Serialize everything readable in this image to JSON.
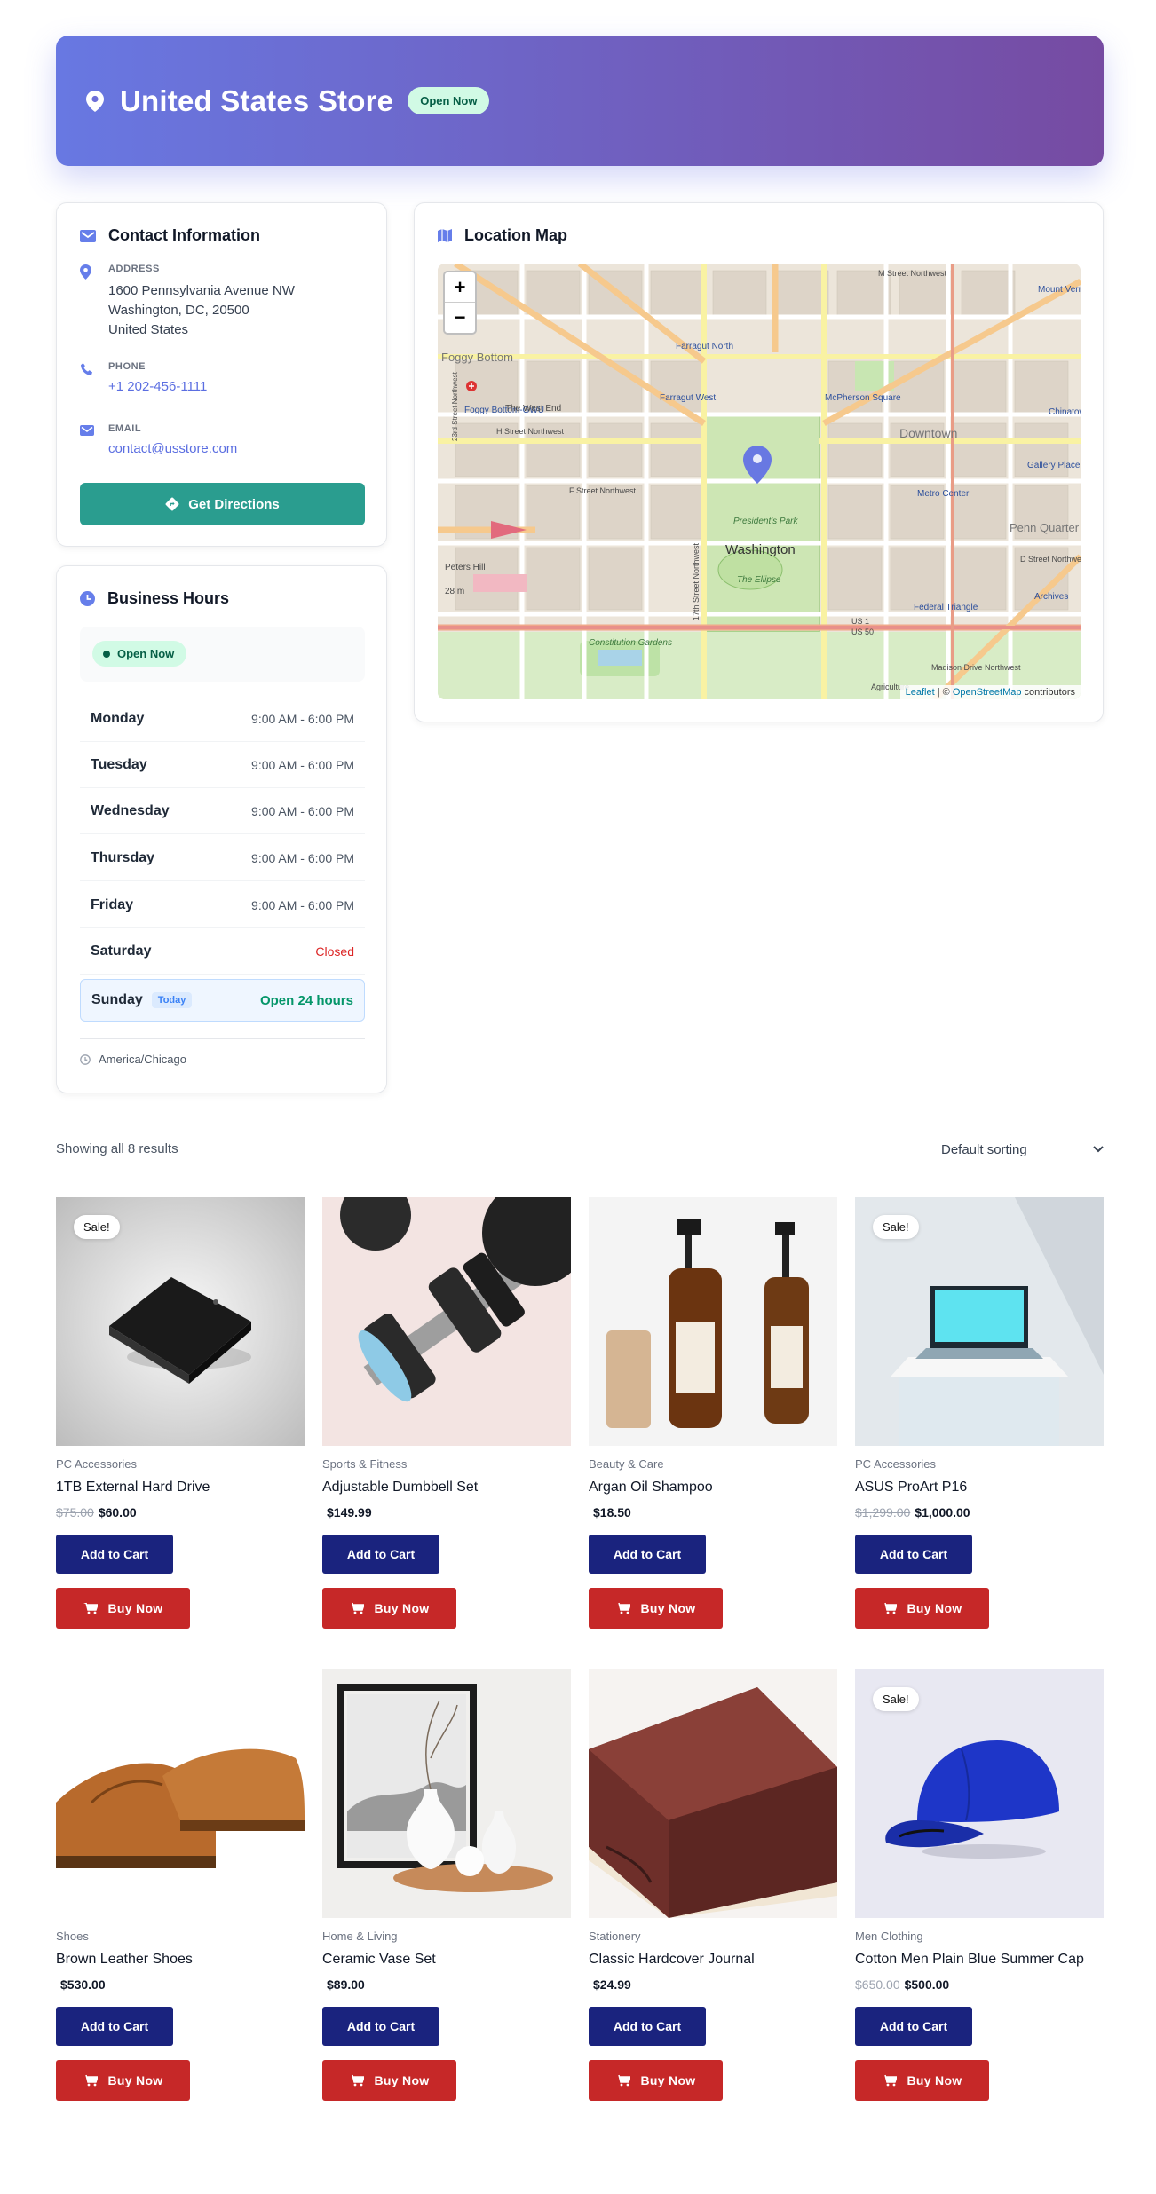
{
  "header": {
    "title": "United States Store",
    "status_badge": "Open Now"
  },
  "contact": {
    "title": "Contact Information",
    "address_label": "ADDRESS",
    "address_lines": [
      "1600 Pennsylvania Avenue NW",
      "Washington, DC, 20500",
      "United States"
    ],
    "phone_label": "PHONE",
    "phone": "+1 202-456-1111",
    "email_label": "EMAIL",
    "email": "contact@usstore.com",
    "directions_button": "Get Directions"
  },
  "hours": {
    "title": "Business Hours",
    "status": "Open Now",
    "days": [
      {
        "day": "Monday",
        "time": "9:00 AM - 6:00 PM"
      },
      {
        "day": "Tuesday",
        "time": "9:00 AM - 6:00 PM"
      },
      {
        "day": "Wednesday",
        "time": "9:00 AM - 6:00 PM"
      },
      {
        "day": "Thursday",
        "time": "9:00 AM - 6:00 PM"
      },
      {
        "day": "Friday",
        "time": "9:00 AM - 6:00 PM"
      },
      {
        "day": "Saturday",
        "time": "Closed"
      },
      {
        "day": "Sunday",
        "time": "Open 24 hours",
        "today_badge": "Today"
      }
    ],
    "timezone": "America/Chicago"
  },
  "map": {
    "title": "Location Map",
    "zoom_in": "+",
    "zoom_out": "−",
    "attribution_leaflet": "Leaflet",
    "attribution_osm": "OpenStreetMap",
    "attribution_rest": " contributors",
    "labels": {
      "foggy_bottom": "Foggy Bottom",
      "foggy_bottom_gwu": "Foggy Bottom-GWU",
      "west_end": "The West End",
      "h_street": "H Street Northwest",
      "f_street": "F Street Northwest",
      "farragut_north": "Farragut North",
      "farragut_west": "Farragut West",
      "mcpherson": "McPherson Square",
      "downtown": "Downtown",
      "metro_center": "Metro Center",
      "presidents_park": "President's Park",
      "washington": "Washington",
      "ellipse": "The Ellipse",
      "constitution_gardens": "Constitution Gardens",
      "federal_triangle": "Federal Triangle",
      "penn_quarter": "Penn Quarter",
      "archives": "Archives",
      "gallery_place": "Gallery Place",
      "chinatown": "Chinatown",
      "mount_vernon": "Mount Vernon Square",
      "m_street": "M Street Northwest",
      "d_street": "D Street Northwest",
      "madison": "Madison Drive Northwest",
      "us1": "US 1",
      "us50": "US 50",
      "seventeenth": "17th Street Northwest",
      "twentythird": "23rd Street Northwest",
      "agriculture": "Agriculture",
      "peters_hill": "Peters Hill",
      "pmm": "28 m"
    }
  },
  "shop": {
    "results_text": "Showing all 8 results",
    "sorting": "Default sorting",
    "add_to_cart": "Add to Cart",
    "buy_now": "Buy Now",
    "sale_badge": "Sale!",
    "products": [
      {
        "category": "PC Accessories",
        "name": "1TB External Hard Drive",
        "old_price": "$75.00",
        "price": "$60.00",
        "sale": true
      },
      {
        "category": "Sports & Fitness",
        "name": "Adjustable Dumbbell Set",
        "old_price": "",
        "price": "$149.99",
        "sale": false
      },
      {
        "category": "Beauty & Care",
        "name": "Argan Oil Shampoo",
        "old_price": "",
        "price": "$18.50",
        "sale": false
      },
      {
        "category": "PC Accessories",
        "name": "ASUS ProArt P16",
        "old_price": "$1,299.00",
        "price": "$1,000.00",
        "sale": true
      },
      {
        "category": "Shoes",
        "name": "Brown Leather Shoes",
        "old_price": "",
        "price": "$530.00",
        "sale": false
      },
      {
        "category": "Home & Living",
        "name": "Ceramic Vase Set",
        "old_price": "",
        "price": "$89.00",
        "sale": false
      },
      {
        "category": "Stationery",
        "name": "Classic Hardcover Journal",
        "old_price": "",
        "price": "$24.99",
        "sale": false
      },
      {
        "category": "Men Clothing",
        "name": "Cotton Men Plain Blue Summer Cap",
        "old_price": "$650.00",
        "price": "$500.00",
        "sale": true
      }
    ]
  },
  "colors": {
    "accent": "#667eea",
    "directions": "#2a9d8f",
    "cart": "#1a237e",
    "buy": "#c62828"
  }
}
